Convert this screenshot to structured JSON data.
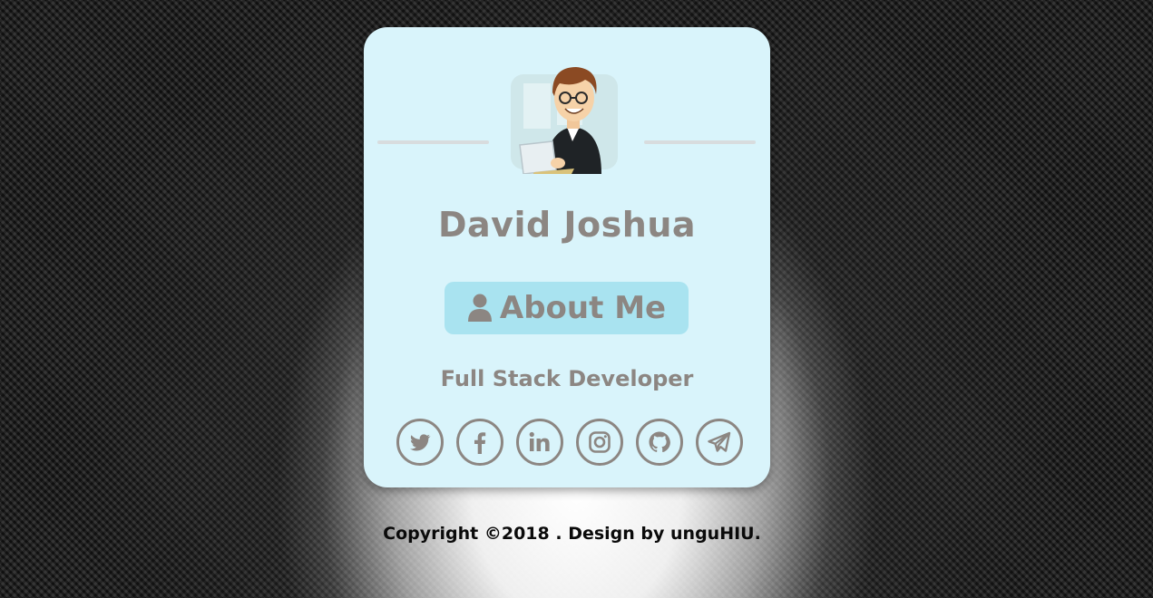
{
  "profile": {
    "name": "David Joshua",
    "about_label": "About Me",
    "role": "Full Stack Developer"
  },
  "socials": [
    {
      "icon": "twitter-icon"
    },
    {
      "icon": "facebook-icon"
    },
    {
      "icon": "linkedin-icon"
    },
    {
      "icon": "instagram-icon"
    },
    {
      "icon": "github-icon"
    },
    {
      "icon": "telegram-icon"
    }
  ],
  "footer": {
    "text": "Copyright ©2018 . Design by unguHIU."
  },
  "colors": {
    "card_bg": "#d9f4fb",
    "button_bg": "#a9e3f0",
    "text_gray": "#8c8682"
  }
}
